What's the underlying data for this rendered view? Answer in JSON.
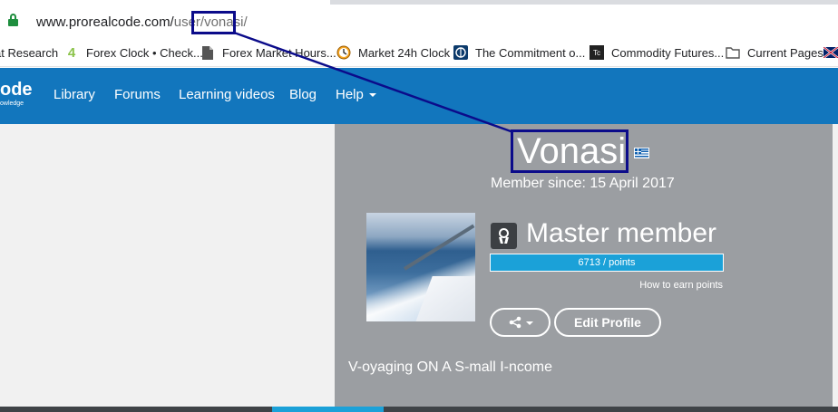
{
  "browser": {
    "url_prefix": "www.prorealcode.com/",
    "url_path": "user/vonasi/"
  },
  "bookmarks": [
    {
      "label": "at Research",
      "icon": "none"
    },
    {
      "label": "Forex Clock • Check...",
      "icon": "number-four-icon",
      "icon_glyph": "4"
    },
    {
      "label": "Forex Market Hours...",
      "icon": "document-icon"
    },
    {
      "label": "Market 24h Clock",
      "icon": "clock-icon"
    },
    {
      "label": "The Commitment o...",
      "icon": "globe-icon"
    },
    {
      "label": "Commodity Futures...",
      "icon": "tc-logo-icon",
      "icon_glyph": "Tc"
    },
    {
      "label": "Current Pages",
      "icon": "folder-icon"
    }
  ],
  "site": {
    "logo_text": "ode",
    "logo_sub": "owledge",
    "nav": [
      {
        "label": "Library"
      },
      {
        "label": "Forums"
      },
      {
        "label": "Learning videos"
      },
      {
        "label": "Blog"
      },
      {
        "label": "Help"
      }
    ]
  },
  "profile": {
    "username": "Vonasi",
    "country_flag": "greece-flag",
    "member_since": "Member since: 15 April 2017",
    "rank": "Master member",
    "points_text": "6713 / points",
    "points_progress": 1.0,
    "how_to_earn": "How to earn points",
    "edit_profile": "Edit Profile",
    "share_icon": "share-icon",
    "bio": "V-oyaging ON A S-mall I-ncome"
  },
  "colors": {
    "header_bg": "#1276bd",
    "profile_bg": "#9b9ea2",
    "points_bar": "#1ba1d8",
    "annotation": "#0b0b8a"
  }
}
